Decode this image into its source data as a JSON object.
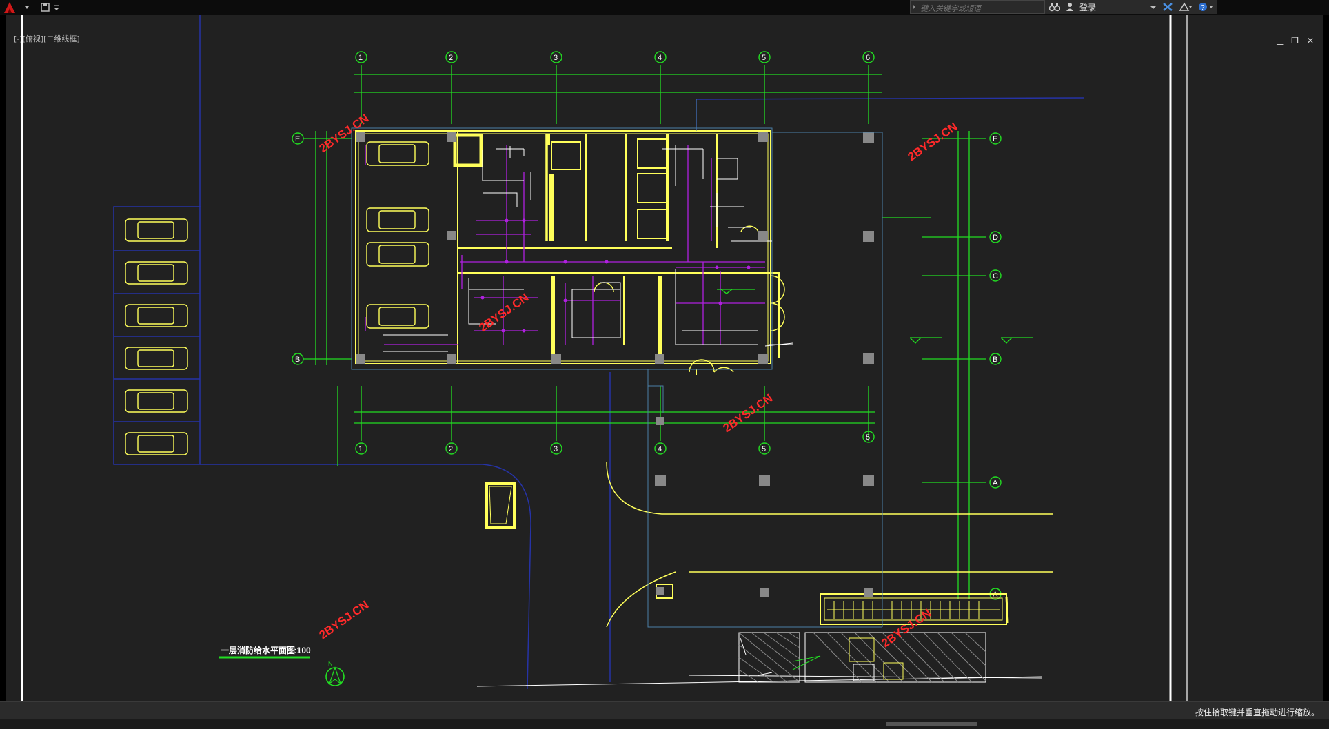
{
  "app": {
    "menu_icon": "autocad-logo-icon",
    "quick_access_icon": "save-icon"
  },
  "search": {
    "placeholder": "键入关键字或短语"
  },
  "infobar": {
    "login_label": "登录"
  },
  "viewport": {
    "label": "[-][俯视][二维线框]"
  },
  "drawing": {
    "grid_top": [
      "1",
      "2",
      "3",
      "4",
      "5",
      "6"
    ],
    "grid_bottom": [
      "1",
      "2",
      "3",
      "4",
      "5",
      "5"
    ],
    "grid_left": [
      "E",
      "B"
    ],
    "grid_right": [
      "E",
      "D",
      "C",
      "B",
      "A",
      "A"
    ],
    "watermark": "2BYSJ.CN",
    "plan_title": "一层消防给水平面图",
    "plan_scale": "1:100",
    "north_label": "N"
  },
  "status": {
    "message": "按住拾取键并垂直拖动进行缩放。"
  },
  "colors": {
    "background": "#212121",
    "walls": "#ffff5a",
    "grid": "#22dd22",
    "pipes": "#b020e0",
    "fixtures": "#ffffff",
    "boundary": "#2633a6",
    "watermark": "#ff2a2a"
  }
}
